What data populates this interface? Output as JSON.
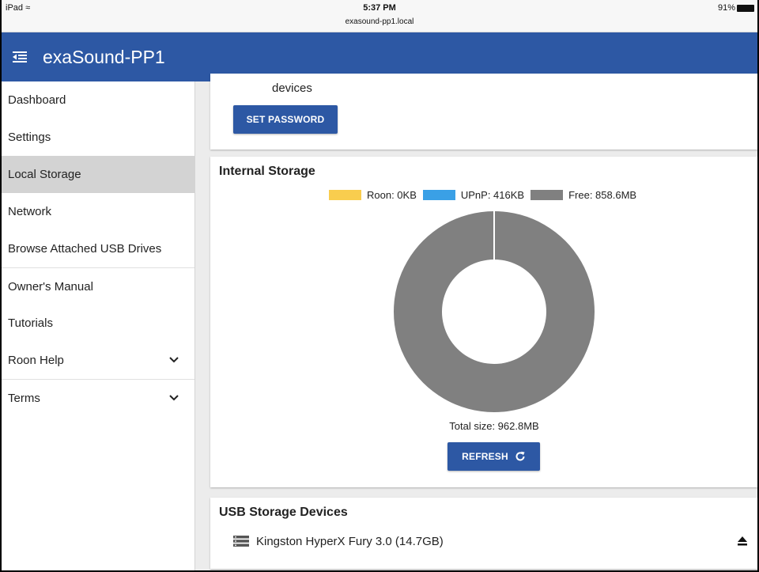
{
  "status_bar": {
    "device": "iPad",
    "time": "5:37 PM",
    "url": "exasound-pp1.local",
    "battery": "91%"
  },
  "app": {
    "title": "exaSound-PP1",
    "accent_color": "#2d58a4"
  },
  "sidebar": {
    "items": [
      {
        "label": "Dashboard"
      },
      {
        "label": "Settings"
      },
      {
        "label": "Local Storage"
      },
      {
        "label": "Network"
      },
      {
        "label": "Browse Attached USB Drives"
      },
      {
        "label": "Owner's Manual"
      },
      {
        "label": "Tutorials"
      },
      {
        "label": "Roon Help"
      },
      {
        "label": "Terms"
      }
    ]
  },
  "password_card": {
    "text": "devices",
    "button": "SET PASSWORD"
  },
  "internal_storage": {
    "title": "Internal Storage",
    "legend": [
      {
        "label": "Roon: 0KB",
        "color": "#f9cd4e"
      },
      {
        "label": "UPnP: 416KB",
        "color": "#3aa0e6"
      },
      {
        "label": "Free: 858.6MB",
        "color": "#808080"
      }
    ],
    "total": "Total size: 962.8MB",
    "refresh_button": "REFRESH"
  },
  "chart_data": {
    "type": "pie",
    "categories": [
      "Roon",
      "UPnP",
      "Free"
    ],
    "values": [
      0,
      0.416,
      858.6
    ],
    "colors": [
      "#f9cd4e",
      "#3aa0e6",
      "#808080"
    ]
  },
  "usb_storage": {
    "title": "USB Storage Devices",
    "devices": [
      {
        "name": "Kingston HyperX Fury 3.0 (14.7GB)"
      }
    ]
  }
}
